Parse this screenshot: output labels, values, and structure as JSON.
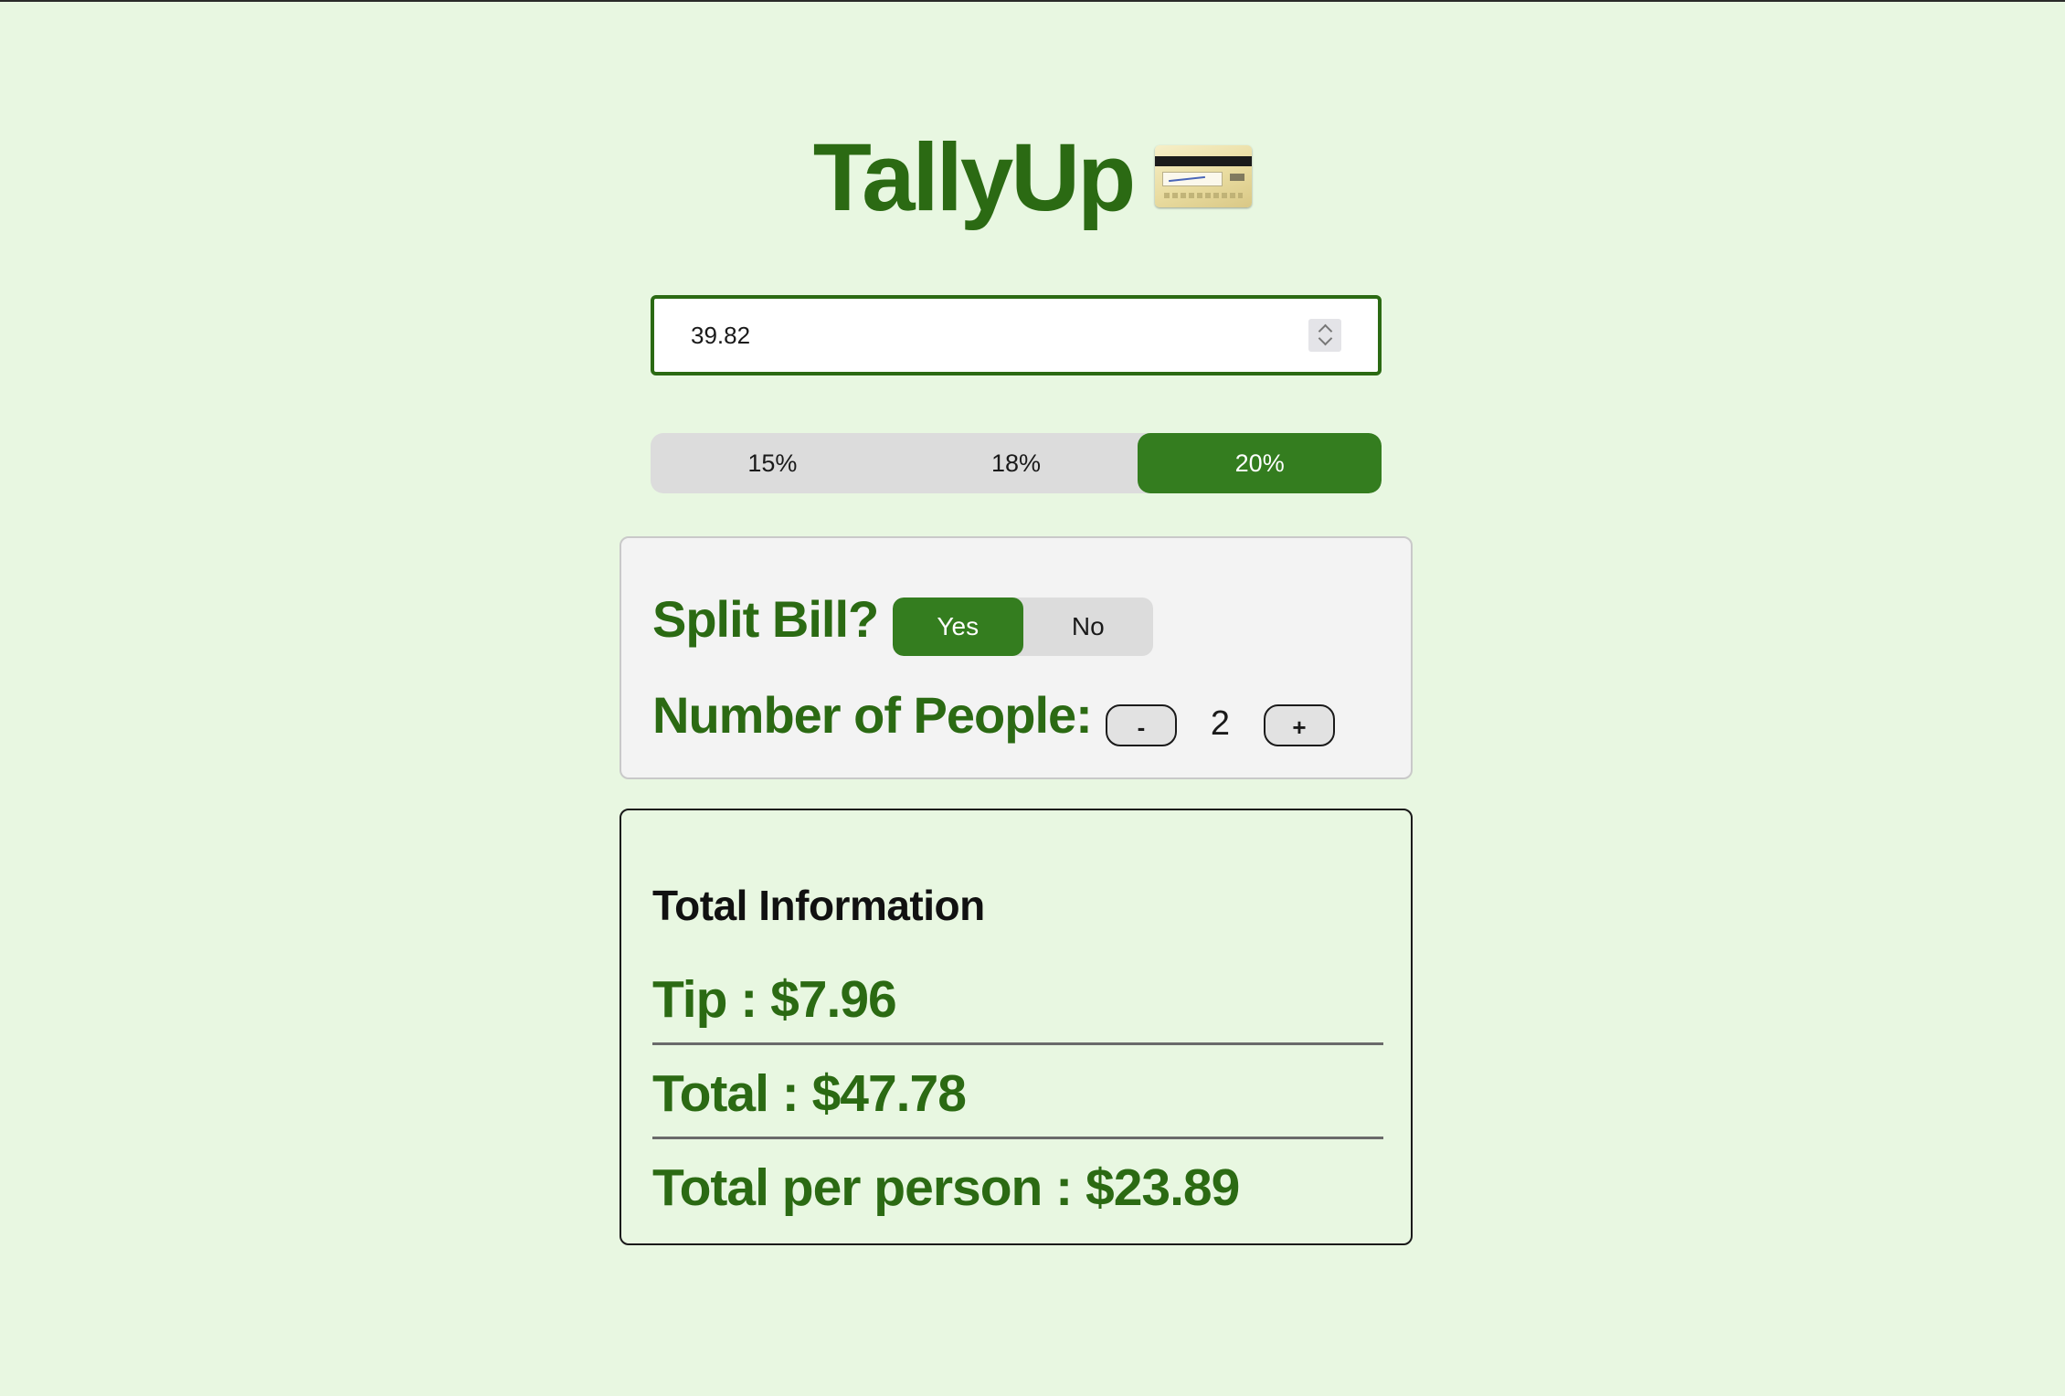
{
  "app": {
    "title": "TallyUp",
    "title_icon": "credit-card-icon"
  },
  "bill": {
    "value": "39.82",
    "spinner_icon": "number-spinner-icon"
  },
  "tip": {
    "options": [
      "15%",
      "18%",
      "20%"
    ],
    "selected": "20%"
  },
  "split": {
    "label": "Split Bill?",
    "yes_label": "Yes",
    "no_label": "No",
    "selected": "Yes",
    "people_label": "Number of People:",
    "minus_label": "-",
    "plus_label": "+",
    "people_count": "2"
  },
  "totals": {
    "heading": "Total Information",
    "tip_line": "Tip : $7.96",
    "total_line": "Total : $47.78",
    "per_person_line": "Total per person : $23.89"
  },
  "colors": {
    "background": "#e8f7e1",
    "brand_green": "#2b6a13",
    "active_green": "#347d1f",
    "inactive_gray": "#dcdcdc"
  }
}
